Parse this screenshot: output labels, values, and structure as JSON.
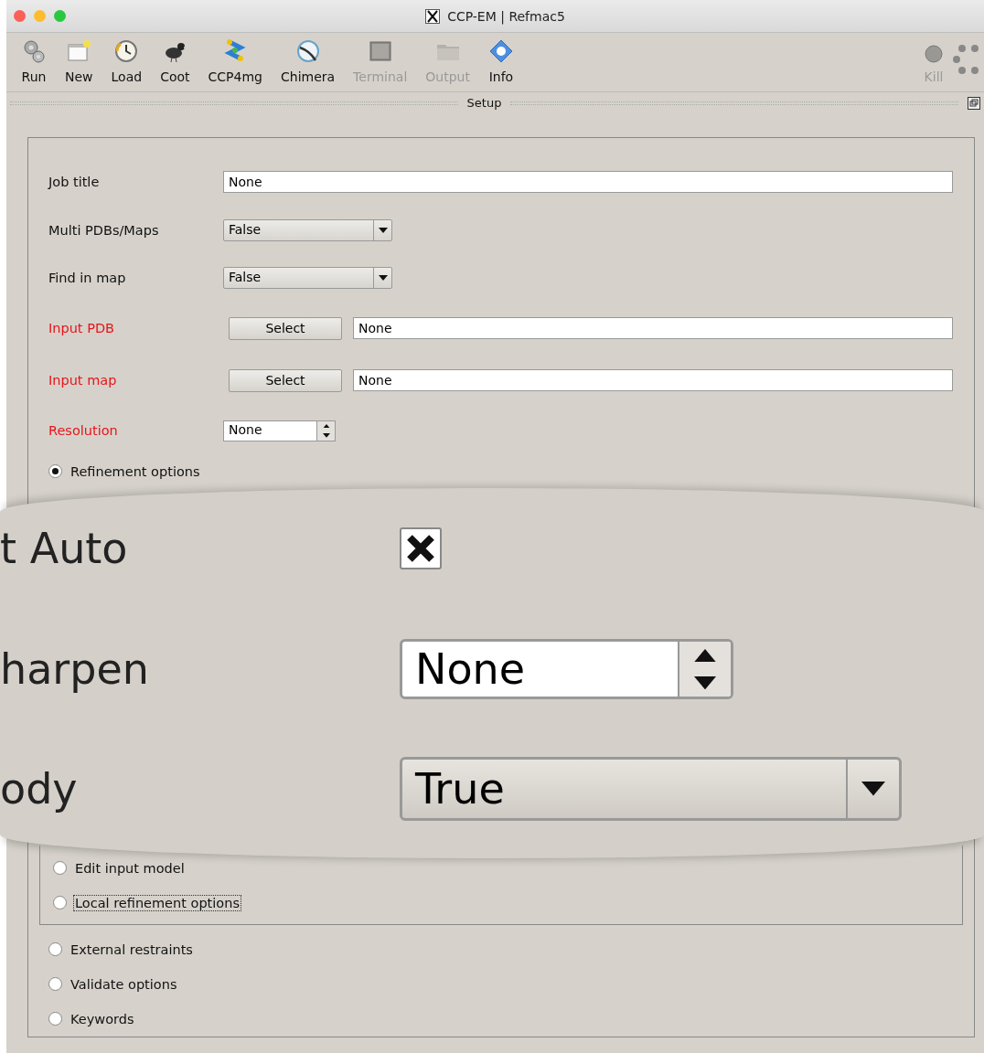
{
  "window": {
    "title": "CCP-EM | Refmac5"
  },
  "toolbar": {
    "items": [
      {
        "label": "Run",
        "disabled": false
      },
      {
        "label": "New",
        "disabled": false
      },
      {
        "label": "Load",
        "disabled": false
      },
      {
        "label": "Coot",
        "disabled": false
      },
      {
        "label": "CCP4mg",
        "disabled": false
      },
      {
        "label": "Chimera",
        "disabled": false
      },
      {
        "label": "Terminal",
        "disabled": true
      },
      {
        "label": "Output",
        "disabled": true
      },
      {
        "label": "Info",
        "disabled": false
      }
    ],
    "kill": {
      "label": "Kill",
      "disabled": true
    }
  },
  "section": {
    "title": "Setup"
  },
  "fields": [
    {
      "kind": "text",
      "label": "Job title",
      "required": false,
      "value": "None"
    },
    {
      "kind": "combo",
      "label": "Multi PDBs/Maps",
      "required": false,
      "value": "False"
    },
    {
      "kind": "combo",
      "label": "Find in map",
      "required": false,
      "value": "False"
    },
    {
      "kind": "file",
      "label": "Input PDB",
      "required": true,
      "button": "Select",
      "value": "None"
    },
    {
      "kind": "file",
      "label": "Input map",
      "required": true,
      "button": "Select",
      "value": "None"
    },
    {
      "kind": "spin",
      "label": "Resolution",
      "required": true,
      "value": "None"
    }
  ],
  "refinement": {
    "label": "Refinement options",
    "selected": true
  },
  "magnifier": {
    "rows": [
      {
        "kind": "checkbox",
        "label": "t Auto",
        "checked": true
      },
      {
        "kind": "spin",
        "label": "harpen",
        "value": "None"
      },
      {
        "kind": "combo",
        "label": "ody",
        "value": "True"
      }
    ]
  },
  "sub_options": [
    {
      "label": "Edit input model",
      "selected": false,
      "focused": false
    },
    {
      "label": "Local refinement options",
      "selected": false,
      "focused": true
    }
  ],
  "options": [
    {
      "label": "External restraints",
      "selected": false
    },
    {
      "label": "Validate options",
      "selected": false
    },
    {
      "label": "Keywords",
      "selected": false
    }
  ]
}
